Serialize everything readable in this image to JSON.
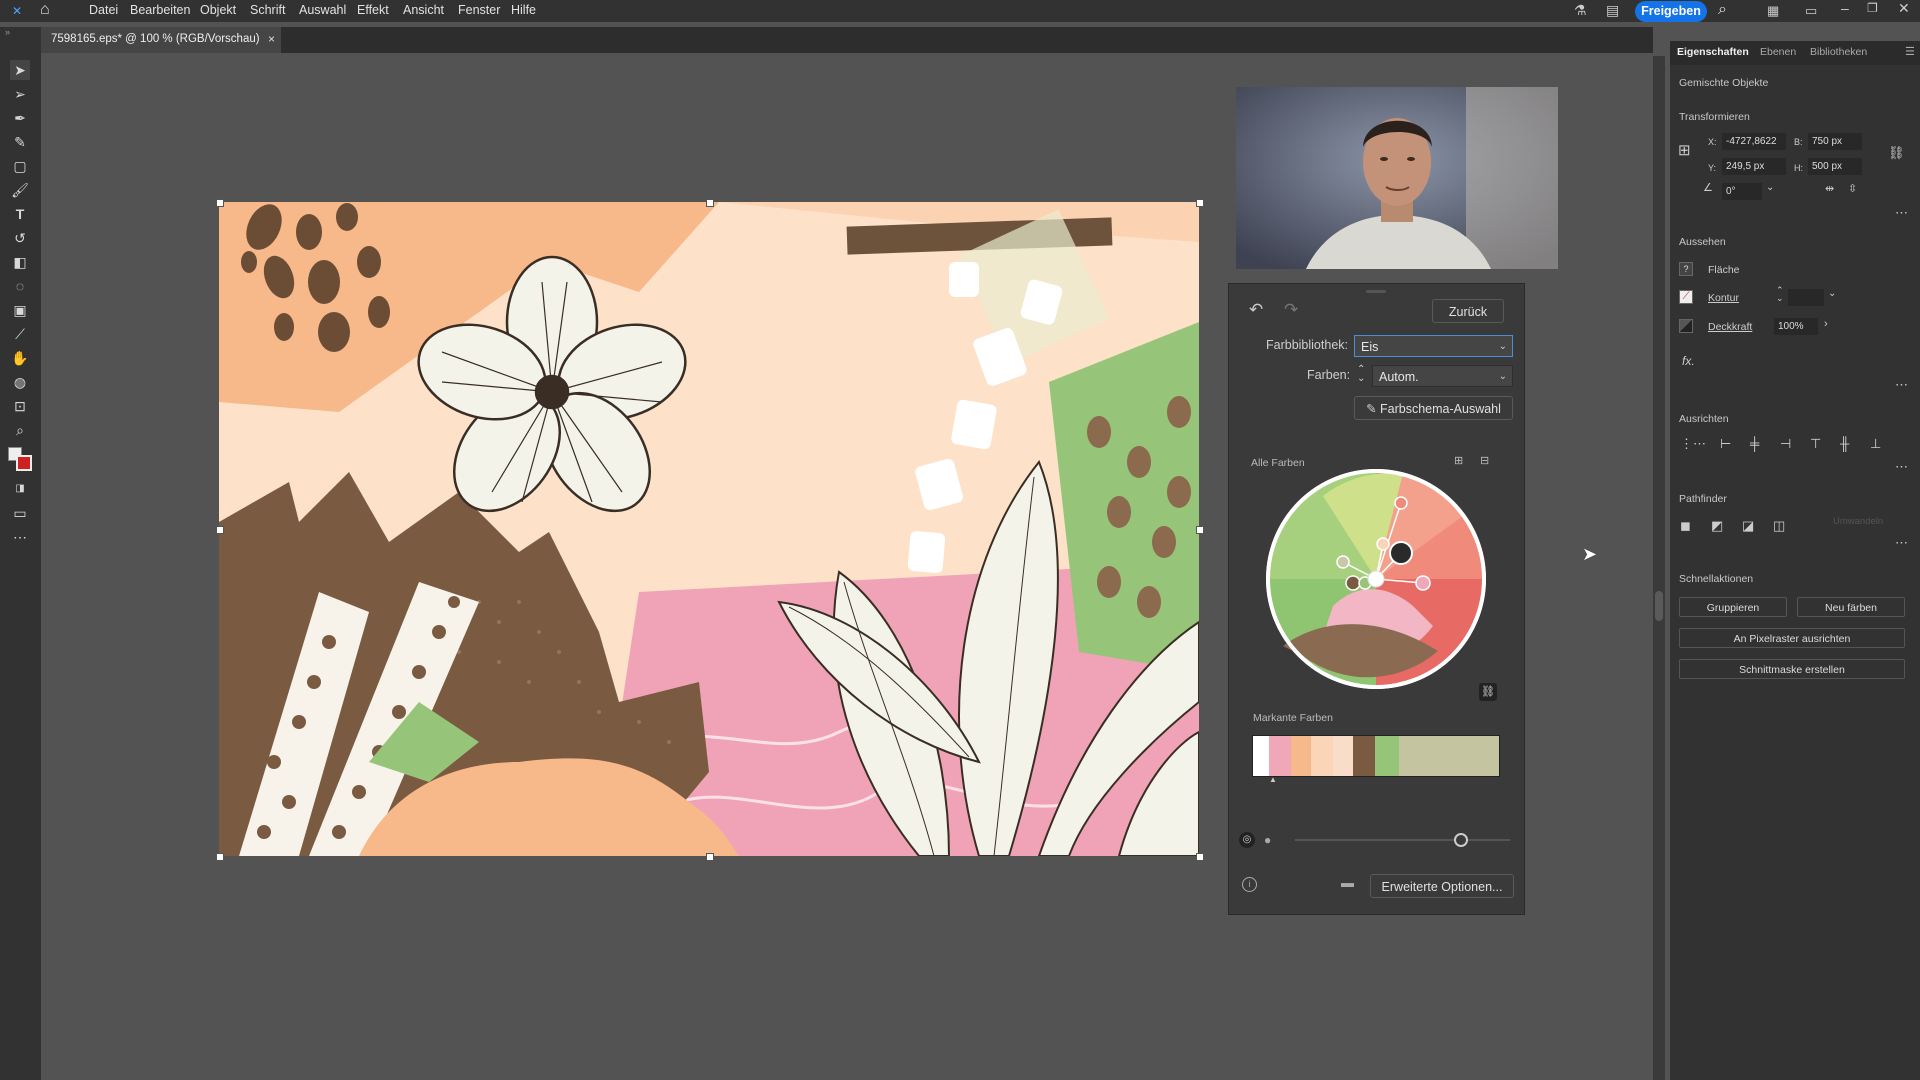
{
  "menu": {
    "items": [
      "Datei",
      "Bearbeiten",
      "Objekt",
      "Schrift",
      "Auswahl",
      "Effekt",
      "Ansicht",
      "Fenster",
      "Hilfe"
    ],
    "share_label": "Freigeben"
  },
  "document": {
    "tab_title": "7598165.eps* @ 100 % (RGB/Vorschau)",
    "close_glyph": "×"
  },
  "recolor": {
    "back_label": "Zurück",
    "library_label": "Farbbibliothek:",
    "library_value": "Eis",
    "colors_label": "Farben:",
    "colors_value": "Autom.",
    "scheme_button": "Farbschema-Auswahl",
    "all_colors_label": "Alle Farben",
    "prominent_label": "Markante Farben",
    "advanced_button": "Erweiterte Optionen...",
    "prominent_colors": [
      "#ffffff",
      "#f0a8b8",
      "#f6b98c",
      "#fbd5b8",
      "#f9ddc8",
      "#7b5a42",
      "#96c57a",
      "#c4c4a0",
      "#c6c8a8"
    ]
  },
  "panel": {
    "tabs": [
      "Eigenschaften",
      "Ebenen",
      "Bibliotheken"
    ],
    "object_type": "Gemischte Objekte",
    "transform_title": "Transformieren",
    "x_label": "X:",
    "x_value": "-4727,8622",
    "y_label": "Y:",
    "y_value": "249,5 px",
    "w_label": "B:",
    "w_value": "750 px",
    "h_label": "H:",
    "h_value": "500 px",
    "angle_value": "0°",
    "appearance_title": "Aussehen",
    "fill_label": "Fläche",
    "stroke_label": "Kontur",
    "opacity_label": "Deckkraft",
    "opacity_value": "100%",
    "fx_label": "fx.",
    "align_title": "Ausrichten",
    "pathfinder_title": "Pathfinder",
    "expand_label": "Umwandeln",
    "quick_title": "Schnellaktionen",
    "group_button": "Gruppieren",
    "recolor_button": "Neu färben",
    "pixel_button": "An Pixelraster ausrichten",
    "mask_button": "Schnittmaske erstellen"
  }
}
